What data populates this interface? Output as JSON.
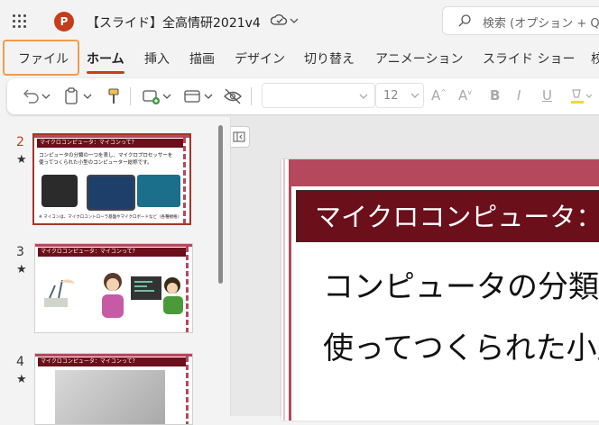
{
  "header": {
    "app_logo_letter": "P",
    "doc_title": "【スライド】全高情研2021v4",
    "search_placeholder": "検索 (オプション + Q)"
  },
  "tabs": [
    "ファイル",
    "ホーム",
    "挿入",
    "描画",
    "デザイン",
    "切り替え",
    "アニメーション",
    "スライド ショー",
    "校"
  ],
  "active_tab": "ホーム",
  "ribbon": {
    "font_name": "",
    "font_size": "12"
  },
  "thumbnails": [
    {
      "num": "2",
      "title": "マイクロコンピュータ：マイコンって？",
      "line1": "コンピュータの分類の一つを表し、マイクロプロセッサーを",
      "line2": "使ってつくられた小型のコンピューター総称です。",
      "caption": "※ マイコンは、マイクロコントローラ基盤やマイクロボードなど（各種規格）"
    },
    {
      "num": "3",
      "title": "マイクロコンピュータ：マイコンって？"
    },
    {
      "num": "4",
      "title": "マイクロコンピュータ：マイコンって？"
    }
  ],
  "slide": {
    "title": "マイクロコンピュータ：マイコンって？",
    "line1": "コンピュータの分類の一つを表し、",
    "line2": "使ってつくられた小型のコンピュータ"
  },
  "colors": {
    "accent": "#c43e1c",
    "slide_title_bg": "#6b0f1a",
    "slide_bar": "#b5485d",
    "file_highlight": "#f29b4b"
  }
}
